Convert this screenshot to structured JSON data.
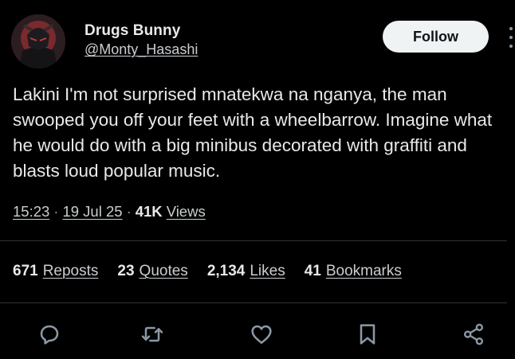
{
  "tweet": {
    "author": {
      "display_name": "Drugs Bunny",
      "handle": "@Monty_Hasashi"
    },
    "follow_label": "Follow",
    "text": "Lakini I'm not surprised mnatekwa na nganya, the man swooped you off your feet with a wheelbarrow. Imagine what he would do with a big minibus decorated with graffiti and blasts loud popular music.",
    "meta": {
      "time": "15:23",
      "separator": "·",
      "date": "19 Jul 25",
      "views_count": "41K",
      "views_label": "Views"
    },
    "stats": [
      {
        "count": "671",
        "label": "Reposts"
      },
      {
        "count": "23",
        "label": "Quotes"
      },
      {
        "count": "2,134",
        "label": "Likes"
      },
      {
        "count": "41",
        "label": "Bookmarks"
      }
    ],
    "actions": [
      {
        "name": "reply",
        "icon": "reply-icon"
      },
      {
        "name": "repost",
        "icon": "repost-icon"
      },
      {
        "name": "like",
        "icon": "heart-icon"
      },
      {
        "name": "bookmark",
        "icon": "bookmark-icon"
      },
      {
        "name": "share",
        "icon": "share-icon"
      }
    ]
  },
  "colors": {
    "background": "#000000",
    "text_primary": "#e7e9ea",
    "text_secondary": "#c9cdd1",
    "icon": "#8b98a5",
    "divider": "#2f3336",
    "follow_bg": "#eff3f4"
  }
}
